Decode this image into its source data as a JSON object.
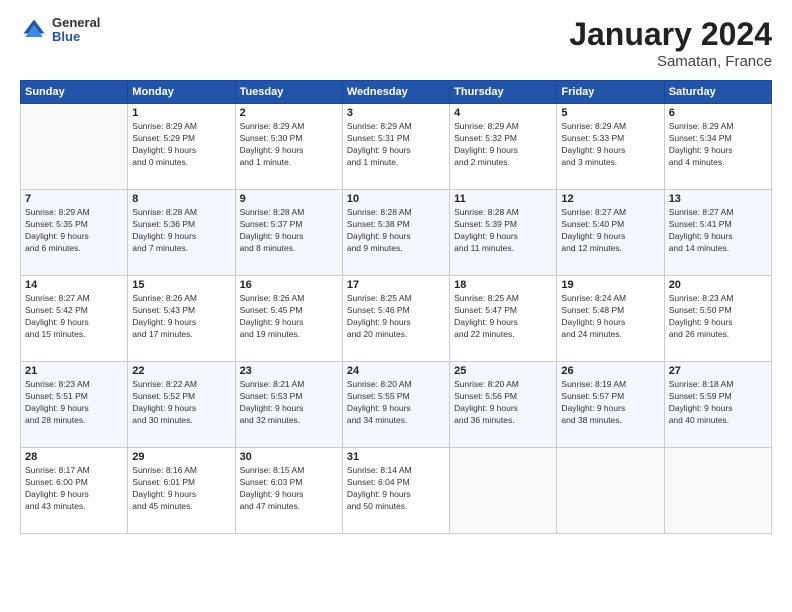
{
  "header": {
    "logo": {
      "general": "General",
      "blue": "Blue"
    },
    "title": "January 2024",
    "location": "Samatan, France"
  },
  "weekdays": [
    "Sunday",
    "Monday",
    "Tuesday",
    "Wednesday",
    "Thursday",
    "Friday",
    "Saturday"
  ],
  "weeks": [
    [
      {
        "day": "",
        "info": ""
      },
      {
        "day": "1",
        "info": "Sunrise: 8:29 AM\nSunset: 5:29 PM\nDaylight: 9 hours\nand 0 minutes."
      },
      {
        "day": "2",
        "info": "Sunrise: 8:29 AM\nSunset: 5:30 PM\nDaylight: 9 hours\nand 1 minute."
      },
      {
        "day": "3",
        "info": "Sunrise: 8:29 AM\nSunset: 5:31 PM\nDaylight: 9 hours\nand 1 minute."
      },
      {
        "day": "4",
        "info": "Sunrise: 8:29 AM\nSunset: 5:32 PM\nDaylight: 9 hours\nand 2 minutes."
      },
      {
        "day": "5",
        "info": "Sunrise: 8:29 AM\nSunset: 5:33 PM\nDaylight: 9 hours\nand 3 minutes."
      },
      {
        "day": "6",
        "info": "Sunrise: 8:29 AM\nSunset: 5:34 PM\nDaylight: 9 hours\nand 4 minutes."
      }
    ],
    [
      {
        "day": "7",
        "info": "Sunrise: 8:29 AM\nSunset: 5:35 PM\nDaylight: 9 hours\nand 6 minutes."
      },
      {
        "day": "8",
        "info": "Sunrise: 8:28 AM\nSunset: 5:36 PM\nDaylight: 9 hours\nand 7 minutes."
      },
      {
        "day": "9",
        "info": "Sunrise: 8:28 AM\nSunset: 5:37 PM\nDaylight: 9 hours\nand 8 minutes."
      },
      {
        "day": "10",
        "info": "Sunrise: 8:28 AM\nSunset: 5:38 PM\nDaylight: 9 hours\nand 9 minutes."
      },
      {
        "day": "11",
        "info": "Sunrise: 8:28 AM\nSunset: 5:39 PM\nDaylight: 9 hours\nand 11 minutes."
      },
      {
        "day": "12",
        "info": "Sunrise: 8:27 AM\nSunset: 5:40 PM\nDaylight: 9 hours\nand 12 minutes."
      },
      {
        "day": "13",
        "info": "Sunrise: 8:27 AM\nSunset: 5:41 PM\nDaylight: 9 hours\nand 14 minutes."
      }
    ],
    [
      {
        "day": "14",
        "info": "Sunrise: 8:27 AM\nSunset: 5:42 PM\nDaylight: 9 hours\nand 15 minutes."
      },
      {
        "day": "15",
        "info": "Sunrise: 8:26 AM\nSunset: 5:43 PM\nDaylight: 9 hours\nand 17 minutes."
      },
      {
        "day": "16",
        "info": "Sunrise: 8:26 AM\nSunset: 5:45 PM\nDaylight: 9 hours\nand 19 minutes."
      },
      {
        "day": "17",
        "info": "Sunrise: 8:25 AM\nSunset: 5:46 PM\nDaylight: 9 hours\nand 20 minutes."
      },
      {
        "day": "18",
        "info": "Sunrise: 8:25 AM\nSunset: 5:47 PM\nDaylight: 9 hours\nand 22 minutes."
      },
      {
        "day": "19",
        "info": "Sunrise: 8:24 AM\nSunset: 5:48 PM\nDaylight: 9 hours\nand 24 minutes."
      },
      {
        "day": "20",
        "info": "Sunrise: 8:23 AM\nSunset: 5:50 PM\nDaylight: 9 hours\nand 26 minutes."
      }
    ],
    [
      {
        "day": "21",
        "info": "Sunrise: 8:23 AM\nSunset: 5:51 PM\nDaylight: 9 hours\nand 28 minutes."
      },
      {
        "day": "22",
        "info": "Sunrise: 8:22 AM\nSunset: 5:52 PM\nDaylight: 9 hours\nand 30 minutes."
      },
      {
        "day": "23",
        "info": "Sunrise: 8:21 AM\nSunset: 5:53 PM\nDaylight: 9 hours\nand 32 minutes."
      },
      {
        "day": "24",
        "info": "Sunrise: 8:20 AM\nSunset: 5:55 PM\nDaylight: 9 hours\nand 34 minutes."
      },
      {
        "day": "25",
        "info": "Sunrise: 8:20 AM\nSunset: 5:56 PM\nDaylight: 9 hours\nand 36 minutes."
      },
      {
        "day": "26",
        "info": "Sunrise: 8:19 AM\nSunset: 5:57 PM\nDaylight: 9 hours\nand 38 minutes."
      },
      {
        "day": "27",
        "info": "Sunrise: 8:18 AM\nSunset: 5:59 PM\nDaylight: 9 hours\nand 40 minutes."
      }
    ],
    [
      {
        "day": "28",
        "info": "Sunrise: 8:17 AM\nSunset: 6:00 PM\nDaylight: 9 hours\nand 43 minutes."
      },
      {
        "day": "29",
        "info": "Sunrise: 8:16 AM\nSunset: 6:01 PM\nDaylight: 9 hours\nand 45 minutes."
      },
      {
        "day": "30",
        "info": "Sunrise: 8:15 AM\nSunset: 6:03 PM\nDaylight: 9 hours\nand 47 minutes."
      },
      {
        "day": "31",
        "info": "Sunrise: 8:14 AM\nSunset: 6:04 PM\nDaylight: 9 hours\nand 50 minutes."
      },
      {
        "day": "",
        "info": ""
      },
      {
        "day": "",
        "info": ""
      },
      {
        "day": "",
        "info": ""
      }
    ]
  ]
}
